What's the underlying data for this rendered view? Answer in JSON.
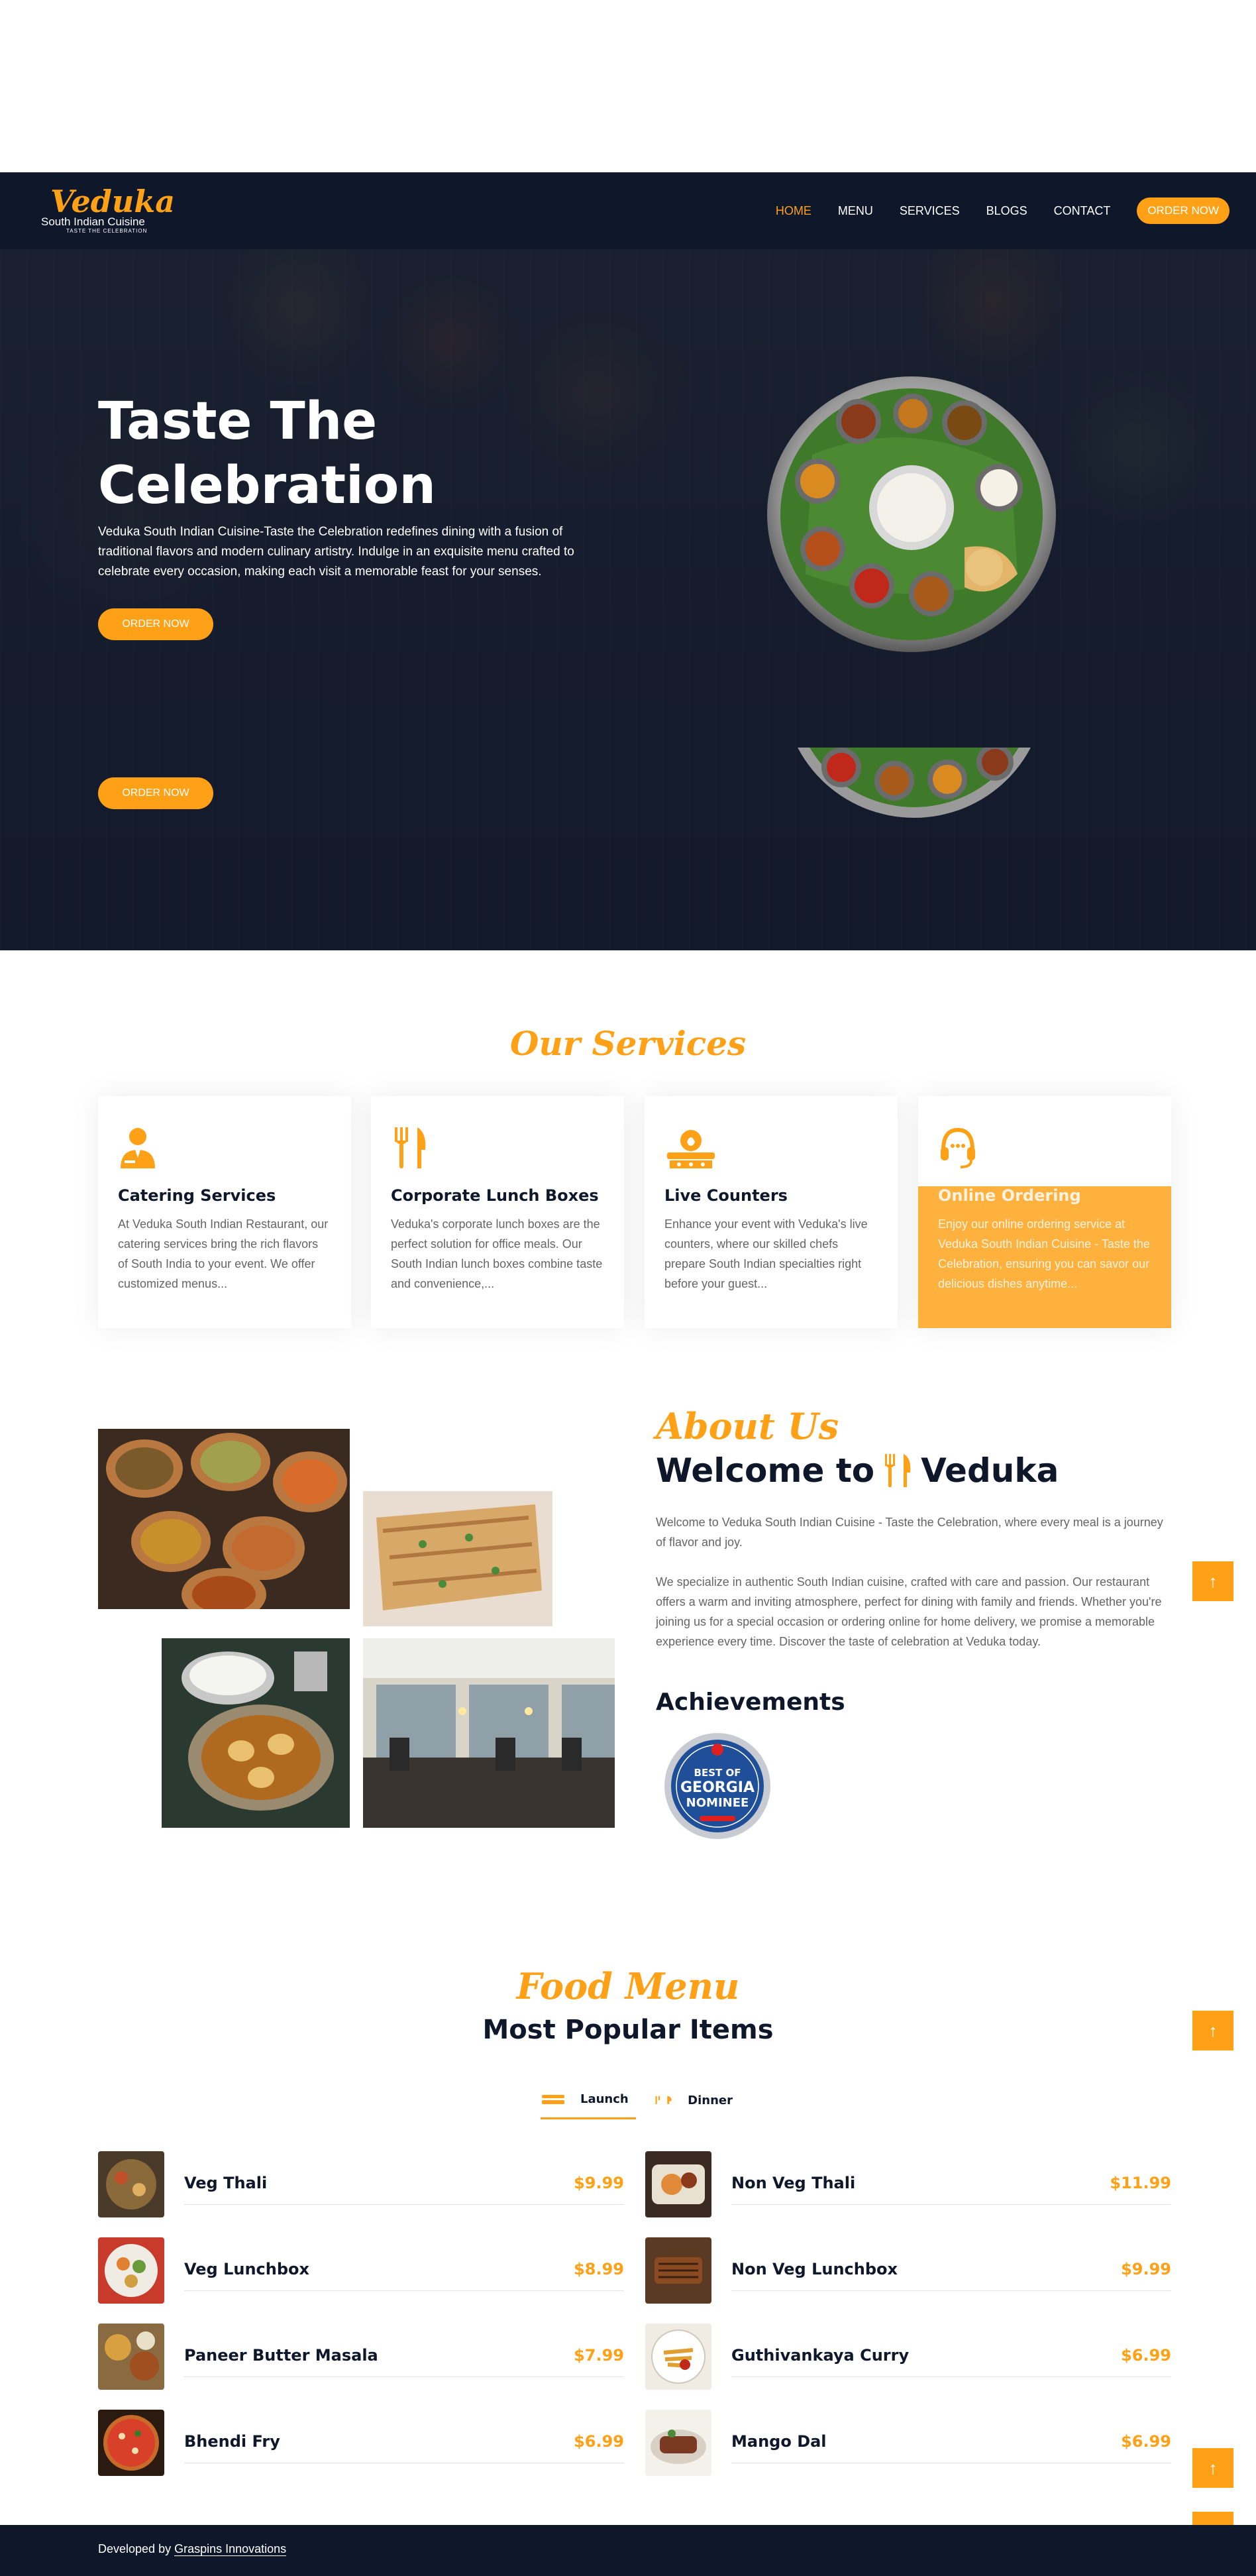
{
  "brand": {
    "name": "Veduka",
    "subtitle": "South Indian Cuisine",
    "tagline": "TASTE THE CELEBRATION"
  },
  "nav": {
    "items": [
      {
        "label": "HOME",
        "active": true
      },
      {
        "label": "MENU",
        "active": false
      },
      {
        "label": "SERVICES",
        "active": false
      },
      {
        "label": "BLOGS",
        "active": false
      },
      {
        "label": "CONTACT",
        "active": false
      }
    ],
    "cta": "ORDER NOW"
  },
  "hero": {
    "title_line1": "Taste The",
    "title_line2": "Celebration",
    "text": "Veduka South Indian Cuisine-Taste the Celebration redefines dining with a fusion of traditional flavors and modern culinary artistry. Indulge in an exquisite menu crafted to celebrate every occasion, making each visit a memorable feast for your senses.",
    "button_label": "ORDER NOW",
    "button2_label": "ORDER NOW"
  },
  "services": {
    "section_title": "Our Services",
    "cards": [
      {
        "icon": "chef-icon",
        "title": "Catering Services",
        "desc": "At Veduka South Indian Restaurant, our catering services bring the rich flavors of South India to your event. We offer customized menus..."
      },
      {
        "icon": "utensils-icon",
        "title": "Corporate Lunch Boxes",
        "desc": "Veduka's corporate lunch boxes are the perfect solution for office meals. Our South Indian lunch boxes combine taste and convenience,..."
      },
      {
        "icon": "live-counter-icon",
        "title": "Live Counters",
        "desc": "Enhance your event with Veduka's live counters, where our skilled chefs prepare South Indian specialties right before your guest..."
      },
      {
        "icon": "headset-icon",
        "title": "Online Ordering",
        "desc": "Enjoy our online ordering service at Veduka South Indian Cuisine - Taste the Celebration, ensuring you can savor our delicious dishes anytime..."
      }
    ]
  },
  "about": {
    "script_title": "About Us",
    "heading_prefix": "Welcome to",
    "heading_brand": "Veduka",
    "p1": "Welcome to Veduka South Indian Cuisine - Taste the Celebration, where every meal is a journey of flavor and joy.",
    "p2": "We specialize in authentic South Indian cuisine, crafted with care and passion. Our restaurant offers a warm and inviting atmosphere, perfect for dining with family and friends. Whether you're joining us for a special occasion or ordering online for home delivery, we promise a memorable experience every time. Discover the taste of celebration at Veduka today.",
    "achievements_title": "Achievements",
    "badge": {
      "line1": "BEST OF",
      "line2": "GEORGIA",
      "line3": "NOMINEE"
    }
  },
  "menu": {
    "script_title": "Food Menu",
    "heading": "Most Popular Items",
    "tabs": [
      {
        "label": "Launch",
        "active": true
      },
      {
        "label": "Dinner",
        "active": false
      }
    ],
    "left_items": [
      {
        "name": "Veg Thali",
        "price": "$9.99"
      },
      {
        "name": "Veg Lunchbox",
        "price": "$8.99"
      },
      {
        "name": "Paneer Butter Masala",
        "price": "$7.99"
      },
      {
        "name": "Bhendi Fry",
        "price": "$6.99"
      }
    ],
    "right_items": [
      {
        "name": "Non Veg Thali",
        "price": "$11.99"
      },
      {
        "name": "Non Veg Lunchbox",
        "price": "$9.99"
      },
      {
        "name": "Guthivankaya Curry",
        "price": "$6.99"
      },
      {
        "name": "Mango Dal",
        "price": "$6.99"
      }
    ]
  },
  "scroll_top_icon": "arrow-up-icon",
  "footer": {
    "prefix": "Developed by",
    "link": "Graspins Innovations"
  },
  "colors": {
    "primary": "#fea116",
    "dark": "#0f172b",
    "text_muted": "#666565"
  }
}
